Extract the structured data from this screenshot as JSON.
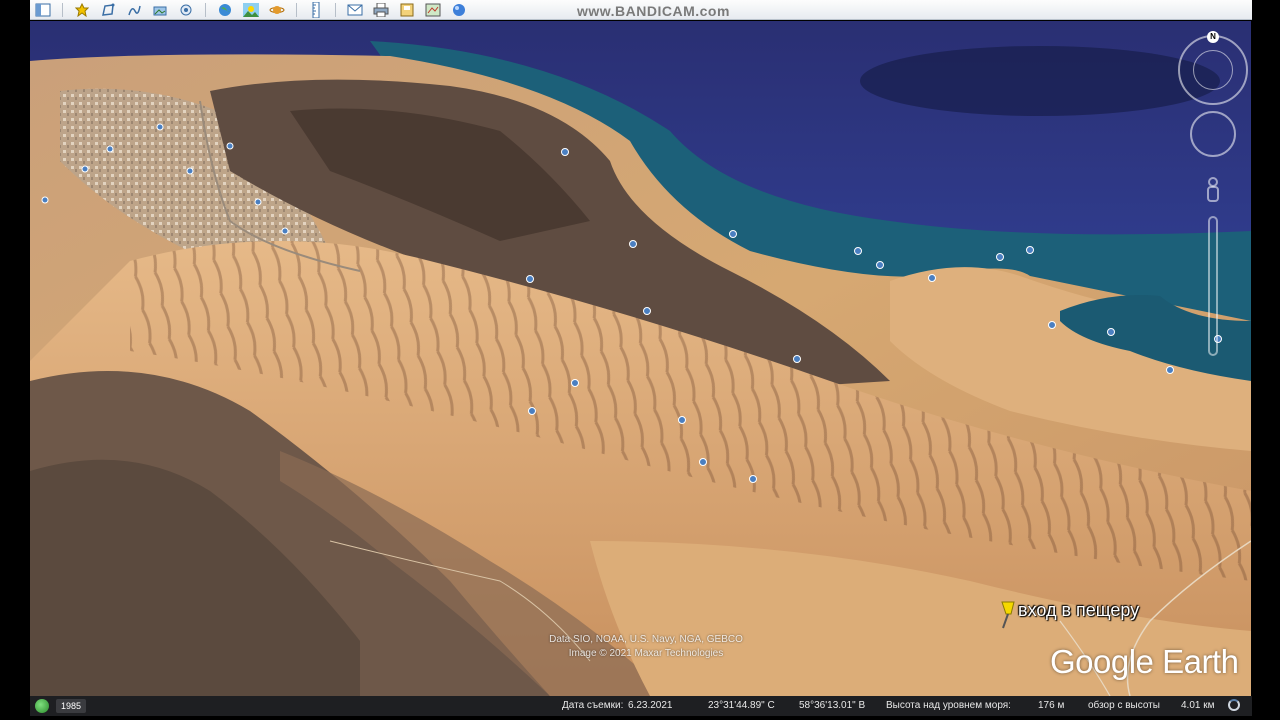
{
  "toolbar": {
    "watermark": "www.BANDICAM.com",
    "buttons": [
      {
        "icon": "sidebar-toggle-icon"
      },
      {
        "icon": "placemark-icon"
      },
      {
        "icon": "polygon-icon"
      },
      {
        "icon": "path-icon"
      },
      {
        "icon": "image-overlay-icon"
      },
      {
        "icon": "record-tour-icon"
      },
      {
        "icon": "historical-imagery-icon"
      },
      {
        "icon": "sunlight-icon"
      },
      {
        "icon": "planets-icon"
      },
      {
        "icon": "ruler-icon"
      },
      {
        "icon": "email-icon"
      },
      {
        "icon": "print-icon"
      },
      {
        "icon": "save-image-icon"
      },
      {
        "icon": "view-in-maps-icon"
      },
      {
        "icon": "sign-in-icon"
      }
    ]
  },
  "map": {
    "placemark_label": "вход  в пещеру",
    "attribution": [
      "Data SIO, NOAA, U.S. Navy, NGA, GEBCO",
      "Image © 2021 Maxar Technologies"
    ],
    "logo_text": "Google Earth",
    "compass_north": "N"
  },
  "status": {
    "year": "1985",
    "imagery_date_label": "Дата съемки:",
    "imagery_date": "6.23.2021",
    "latitude": "23°31'44.89\" С",
    "longitude": "58°36'13.01\" В",
    "elevation_label": "Высота над уровнем моря:",
    "elevation": "176 м",
    "eye_alt_label": "обзор с высоты",
    "eye_alt": "4.01 км"
  },
  "colors": {
    "sea": "#2c3f86",
    "coast_water": "#1c5a73",
    "terrain_light": "#d9a870",
    "terrain_dark": "#5a4a3f",
    "status_bg": "#1e1f22"
  }
}
